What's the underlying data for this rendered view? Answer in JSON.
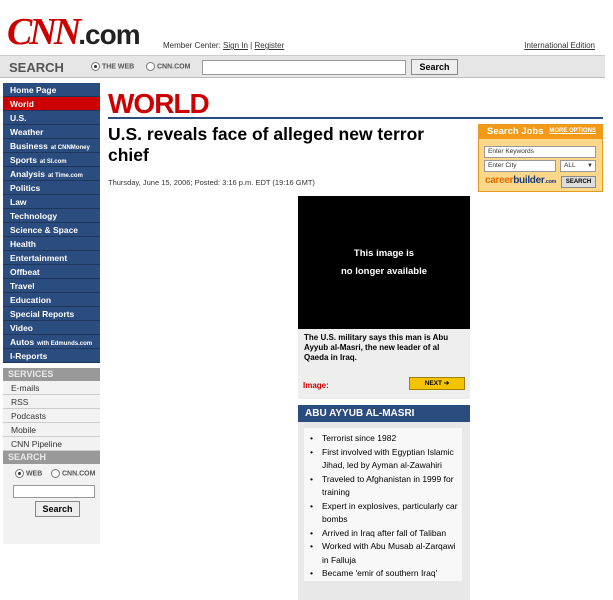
{
  "header": {
    "logo_cnn": "CNN",
    "logo_dotcom": ".com",
    "member_prefix": "Member Center: ",
    "sign_in": "Sign In",
    "separator": " | ",
    "register": "Register",
    "international": "International Edition"
  },
  "searchbar": {
    "label": "SEARCH",
    "opt_web": "THE WEB",
    "opt_cnn": "CNN.COM",
    "button": "Search"
  },
  "nav": {
    "items": [
      {
        "label": "Home Page",
        "sub": ""
      },
      {
        "label": "World",
        "sub": ""
      },
      {
        "label": "U.S.",
        "sub": ""
      },
      {
        "label": "Weather",
        "sub": ""
      },
      {
        "label": "Business",
        "sub": "at CNNMoney"
      },
      {
        "label": "Sports",
        "sub": "at SI.com"
      },
      {
        "label": "Analysis",
        "sub": "at Time.com"
      },
      {
        "label": "Politics",
        "sub": ""
      },
      {
        "label": "Law",
        "sub": ""
      },
      {
        "label": "Technology",
        "sub": ""
      },
      {
        "label": "Science & Space",
        "sub": ""
      },
      {
        "label": "Health",
        "sub": ""
      },
      {
        "label": "Entertainment",
        "sub": ""
      },
      {
        "label": "Offbeat",
        "sub": ""
      },
      {
        "label": "Travel",
        "sub": ""
      },
      {
        "label": "Education",
        "sub": ""
      },
      {
        "label": "Special Reports",
        "sub": ""
      },
      {
        "label": "Video",
        "sub": ""
      },
      {
        "label": "Autos",
        "sub": "with Edmunds.com"
      },
      {
        "label": "I-Reports",
        "sub": ""
      }
    ]
  },
  "services": {
    "title": "SERVICES",
    "items": [
      "E-mails",
      "RSS",
      "Podcasts",
      "Mobile",
      "CNN Pipeline"
    ]
  },
  "left_search": {
    "title": "SEARCH",
    "opt_web": "WEB",
    "opt_cnn": "CNN.COM",
    "button": "Search"
  },
  "main": {
    "section": "WORLD",
    "headline": "U.S. reveals face of alleged new terror chief",
    "dateline": "Thursday, June 15, 2006; Posted: 3:16 p.m. EDT (19:16 GMT)",
    "image_text_1": "This image is",
    "image_text_2": "no longer available",
    "caption": "The U.S. military says this man is Abu Ayyub al-Masri, the new leader of al Qaeda in Iraq.",
    "image_label": "Image:",
    "next": "NEXT"
  },
  "factbox": {
    "title": "ABU AYYUB AL-MASRI",
    "items": [
      "Terrorist since 1982",
      "First involved with Egyptian Islamic Jihad, led by Ayman al-Zawahiri",
      "Traveled to Afghanistan in 1999 for training",
      "Expert in explosives, particularly car bombs",
      "Arrived in Iraq after fall of Taliban",
      "Worked with Abu Musab al-Zarqawi in Falluja",
      "Became 'emir of southern Iraq'"
    ]
  },
  "ad": {
    "title": "Search Jobs",
    "more": "MORE OPTIONS",
    "keywords_placeholder": "Enter Keywords",
    "city_placeholder": "Enter City",
    "select_value": "ALL",
    "logo_career": "career",
    "logo_builder": "builder",
    "logo_com": ".com",
    "button": "SEARCH"
  }
}
